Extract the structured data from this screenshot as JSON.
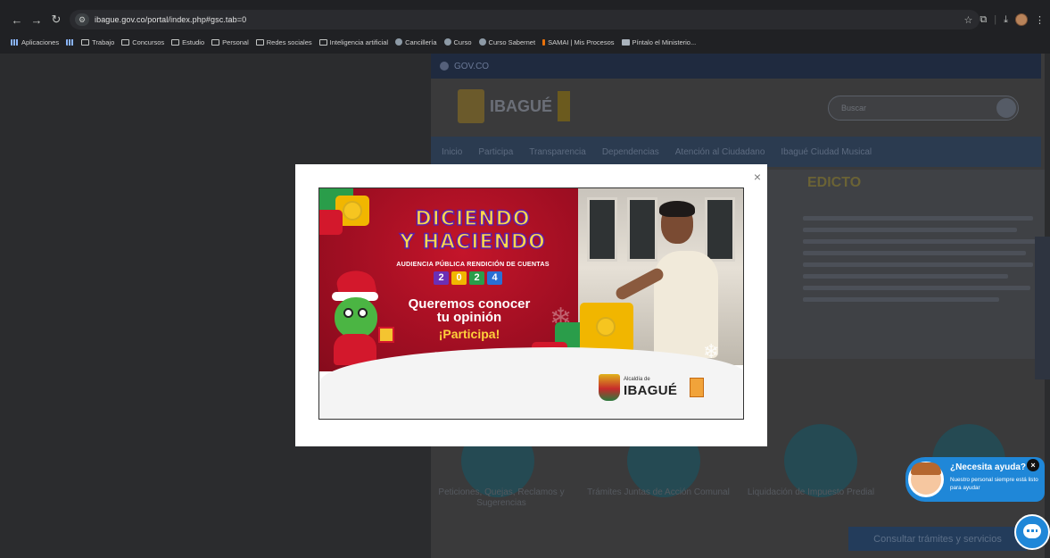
{
  "browser": {
    "url": "ibague.gov.co/portal/index.php#gsc.tab=0",
    "bookmarks": [
      {
        "label": "Aplicaciones",
        "icon": "apps-grid-icon"
      },
      {
        "label": "Trabajo",
        "icon": "folder-icon"
      },
      {
        "label": "Concursos",
        "icon": "folder-icon"
      },
      {
        "label": "Estudio",
        "icon": "folder-icon"
      },
      {
        "label": "Personal",
        "icon": "folder-icon"
      },
      {
        "label": "Redes sociales",
        "icon": "folder-icon"
      },
      {
        "label": "Inteligencia artificial",
        "icon": "folder-icon"
      },
      {
        "label": "Cancillería",
        "icon": "globe-icon"
      },
      {
        "label": "Curso",
        "icon": "course-icon"
      },
      {
        "label": "Curso Sabernet",
        "icon": "course-icon"
      },
      {
        "label": "SAMAI | Mis Procesos",
        "icon": "samai-icon"
      },
      {
        "label": "Píntalo el Ministerio...",
        "icon": "doc-icon"
      }
    ]
  },
  "site": {
    "gov_label": "GOV.CO",
    "logo_text": "IBAGUÉ",
    "search_placeholder": "Buscar",
    "nav": [
      "Inicio",
      "Participa",
      "Transparencia",
      "Dependencias",
      "Atención al Ciudadano",
      "Ibagué Ciudad Musical"
    ],
    "edicto_title": "EDICTO",
    "services": [
      "Peticiones, Quejas, Reclamos y Sugerencias",
      "Trámites Juntas de Acción Comunal",
      "Liquidación de Impuesto Predial"
    ],
    "consult_button": "Consultar trámites y servicios"
  },
  "modal": {
    "close_label": "×",
    "banner": {
      "headline_line1": "DICIENDO",
      "headline_line2": "Y HACIENDO",
      "subhead": "AUDIENCIA PÚBLICA RENDICIÓN DE CUENTAS",
      "year_digits": [
        "2",
        "0",
        "2",
        "4"
      ],
      "year_colors": [
        "#6b2fb5",
        "#f1b600",
        "#2a9d4a",
        "#2a6fd4"
      ],
      "cta_line1": "Queremos conocer",
      "cta_line2": "tu opinión",
      "cta_highlight": "¡Participa!",
      "footer_small": "Alcaldía de",
      "footer_big": "IBAGUÉ"
    }
  },
  "help_widget": {
    "title": "¿Necesita ayuda?",
    "text": "Nuestro personal siempre está listo para ayudar",
    "close_label": "×"
  }
}
